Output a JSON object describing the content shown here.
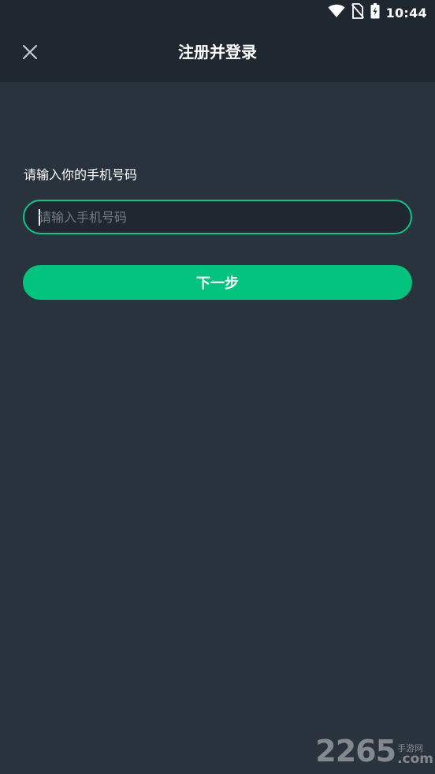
{
  "status_bar": {
    "time": "10:44",
    "icons": [
      "wifi-icon",
      "no-sim-icon",
      "battery-charging-icon"
    ]
  },
  "header": {
    "close_icon": "close-icon",
    "title": "注册并登录"
  },
  "form": {
    "prompt": "请输入你的手机号码",
    "phone_placeholder": "请输入手机号码",
    "phone_value": "",
    "next_button_label": "下一步"
  },
  "watermark": {
    "number": "2265",
    "site_cn": "手游网",
    "domain": ".com"
  },
  "colors": {
    "background": "#29333e",
    "topbar": "#1f2831",
    "accent": "#04c37f",
    "input_border": "#11c582",
    "placeholder": "#6f7a84"
  }
}
